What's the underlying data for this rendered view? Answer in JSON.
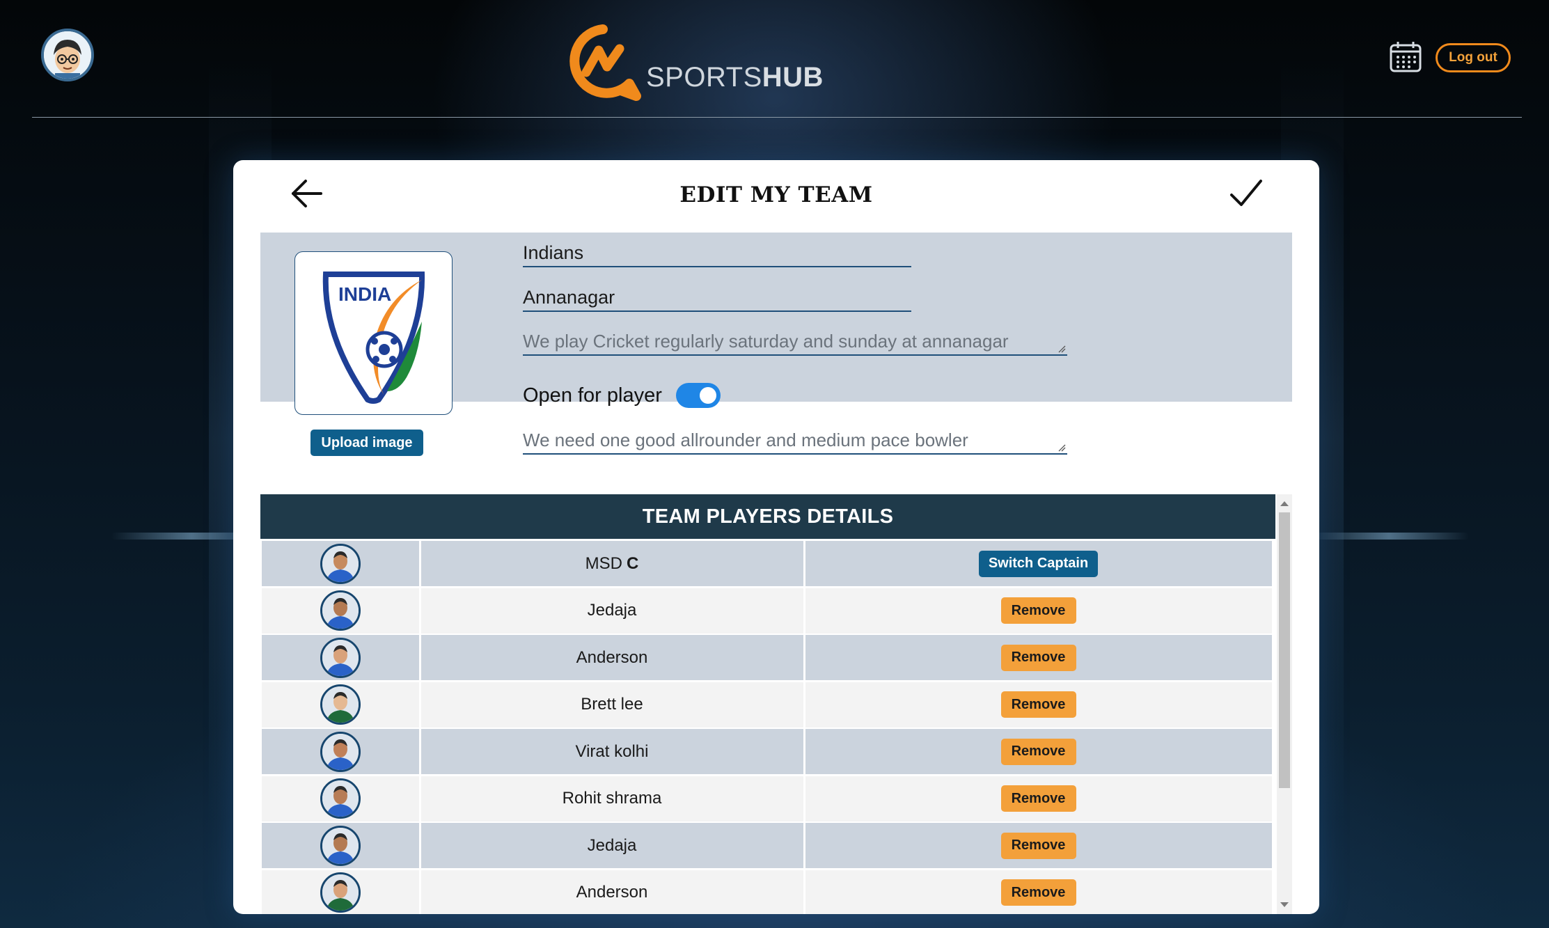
{
  "header": {
    "brand_prefix": "SPORTS",
    "brand_suffix": "HUB",
    "logout_label": "Log out",
    "icons": [
      "user-avatar",
      "calendar-icon"
    ]
  },
  "colors": {
    "accent_orange": "#f08a1c",
    "primary_blue": "#0f5f8c",
    "panel_gray": "#cbd3dd",
    "table_header": "#1f3a4a",
    "toggle_on": "#1f86e6"
  },
  "edit_team": {
    "title": "EDIT MY TEAM",
    "team_name": "Indians",
    "location": "Annanagar",
    "description": "We play Cricket regularly saturday and sunday at annanagar",
    "open_for_player_label": "Open for player",
    "open_for_player": true,
    "requirement": "We need one good allrounder and medium pace bowler",
    "upload_label": "Upload image",
    "logo_text": "INDIA"
  },
  "players_table": {
    "title": "TEAM PLAYERS DETAILS",
    "captain_mark": "C",
    "switch_captain_label": "Switch Captain",
    "remove_label": "Remove",
    "players": [
      {
        "name": "MSD",
        "captain": true
      },
      {
        "name": "Jedaja",
        "captain": false
      },
      {
        "name": "Anderson",
        "captain": false
      },
      {
        "name": "Brett lee",
        "captain": false
      },
      {
        "name": "Virat kolhi",
        "captain": false
      },
      {
        "name": "Rohit shrama",
        "captain": false
      },
      {
        "name": "Jedaja",
        "captain": false
      },
      {
        "name": "Anderson",
        "captain": false
      }
    ]
  }
}
